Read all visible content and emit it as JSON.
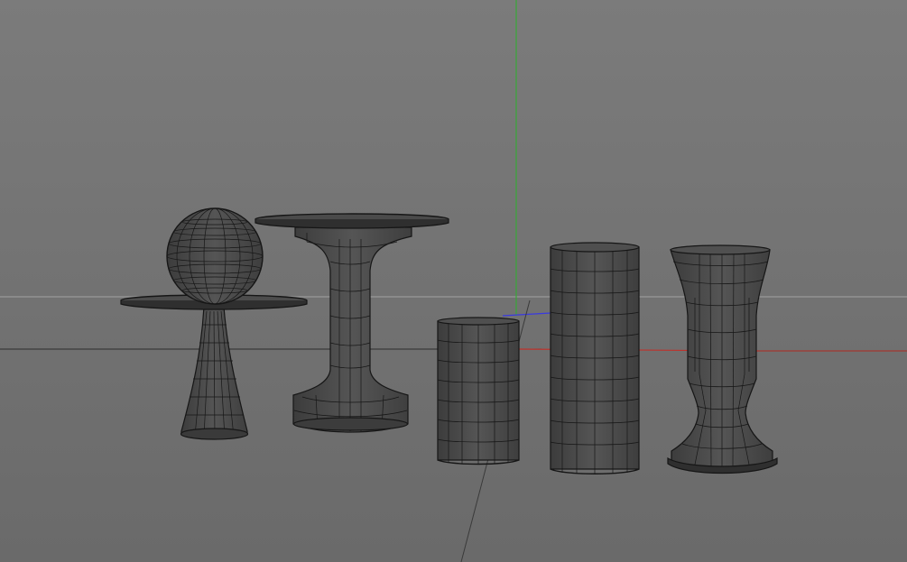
{
  "viewport": {
    "background_top": "#7b7b7b",
    "background_bottom": "#6a6a6a",
    "colors": {
      "axis_x": "#c0302a",
      "axis_y": "#38a838",
      "axis_z": "#3a3ae0",
      "grid_line": "#9a9a9a",
      "mesh_fill": "#4a4a4a",
      "mesh_wire": "#161616"
    },
    "objects": [
      {
        "name": "pedestal-disc-with-sphere"
      },
      {
        "name": "spool-pedestal"
      },
      {
        "name": "short-cylinder"
      },
      {
        "name": "tall-cylinder"
      },
      {
        "name": "goblet-vase"
      }
    ]
  }
}
